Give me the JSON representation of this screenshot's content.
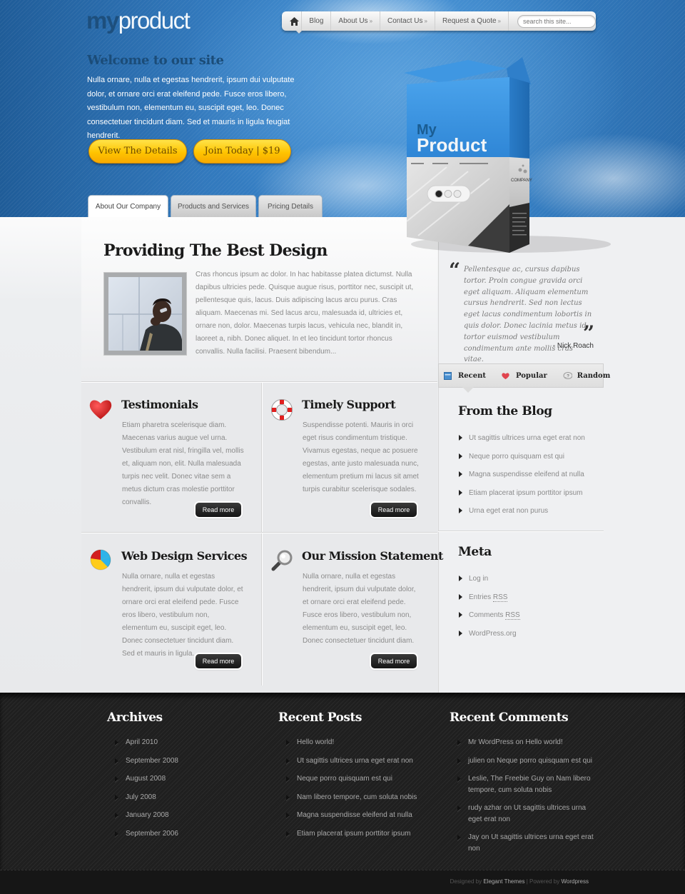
{
  "header": {
    "logo_my": "my",
    "logo_product": "product",
    "nav": {
      "home_icon": "home-icon",
      "items": [
        {
          "label": "Blog",
          "has_submenu": false
        },
        {
          "label": "About Us",
          "has_submenu": true
        },
        {
          "label": "Contact Us",
          "has_submenu": true
        },
        {
          "label": "Request a Quote",
          "has_submenu": true
        }
      ],
      "submenu_glyph": "»",
      "search_placeholder": "search this site..."
    },
    "welcome_title": "Welcome to our site",
    "intro_text": "Nulla ornare, nulla et egestas hendrerit, ipsum dui vulputate dolor, et ornare orci erat eleifend pede. Fusce eros libero, vestibulum non, elementum eu, suscipit eget, leo. Donec consectetuer tincidunt diam. Sed et mauris in ligula feugiat hendrerit.",
    "buttons": {
      "details": "View The Details",
      "join": "Join Today | $19"
    },
    "tabs": [
      {
        "label": "About Our Company",
        "active": true
      },
      {
        "label": "Products and Services",
        "active": false
      },
      {
        "label": "Pricing Details",
        "active": false
      }
    ],
    "product_box": {
      "line1": "My",
      "line2": "Product",
      "company": "COMPANY",
      "slider_active_index": 0,
      "slider_count": 3
    }
  },
  "feature": {
    "title": "Providing The Best Design",
    "text": "Cras rhoncus ipsum ac dolor. In hac habitasse platea dictumst. Nulla dapibus ultricies pede. Quisque augue risus, porttitor nec, suscipit ut, pellentesque quis, lacus. Duis adipiscing lacus arcu purus. Cras aliquam. Maecenas mi. Sed lacus arcu, malesuada id, ultricies et, ornare non, dolor. Maecenas turpis lacus, vehicula nec, blandit in, laoreet a, nibh. Donec aliquet. In et leo tincidunt tortor rhoncus convallis. Nulla facilisi. Praesent bibendum..."
  },
  "services": [
    {
      "icon": "heart-icon",
      "title": "Testimonials",
      "text": "Etiam pharetra scelerisque diam. Maecenas varius augue vel urna. Vestibulum erat nisl, fringilla vel, mollis et, aliquam non, elit. Nulla malesuada turpis nec velit. Donec vitae sem a metus dictum cras molestie porttitor convallis.",
      "button": "Read more"
    },
    {
      "icon": "lifebuoy-icon",
      "title": "Timely Support",
      "text": "Suspendisse potenti. Mauris in orci eget risus condimentum tristique. Vivamus egestas, neque ac posuere egestas, ante justo malesuada nunc, elementum pretium mi lacus sit amet turpis curabitur scelerisque sodales.",
      "button": "Read more"
    },
    {
      "icon": "pie-chart-icon",
      "title": "Web Design Services",
      "text": "Nulla ornare, nulla et egestas hendrerit, ipsum dui vulputate dolor, et ornare orci erat eleifend pede. Fusce eros libero, vestibulum non, elementum eu, suscipit eget, leo. Donec consectetuer tincidunt diam. Sed et mauris in ligula.",
      "button": "Read more"
    },
    {
      "icon": "magnifier-icon",
      "title": "Our Mission Statement",
      "text": "Nulla ornare, nulla et egestas hendrerit, ipsum dui vulputate dolor, et ornare orci erat eleifend pede. Fusce eros libero, vestibulum non, elementum eu, suscipit eget, leo. Donec consectetuer tincidunt diam.",
      "button": "Read more"
    }
  ],
  "sidebar": {
    "quote": {
      "text": "Pellentesque ac, cursus dapibus tortor. Proin congue gravida orci eget aliquam. Aliquam elementum cursus hendrerit. Sed non lectus eget lacus condimentum lobortis in quis dolor. Donec lacinia metus id tortor euismod vestibulum condimentum ante mollis cras vitae.",
      "author": "- Nick Roach",
      "open_mark": "“",
      "close_mark": "”"
    },
    "tabs": [
      {
        "label": "Recent",
        "icon": "calendar-icon"
      },
      {
        "label": "Popular",
        "icon": "heart-icon"
      },
      {
        "label": "Random",
        "icon": "question-bubble-icon"
      }
    ],
    "blog": {
      "title": "From the Blog",
      "items": [
        "Ut sagittis ultrices urna eget erat non",
        "Neque porro quisquam est qui",
        "Magna suspendisse eleifend at nulla",
        "Etiam placerat ipsum porttitor ipsum",
        "Urna eget erat non purus"
      ]
    },
    "meta": {
      "title": "Meta",
      "items": [
        {
          "text": "Log in",
          "abbr": ""
        },
        {
          "text": "Entries ",
          "abbr": "RSS"
        },
        {
          "text": "Comments ",
          "abbr": "RSS"
        },
        {
          "text": "WordPress.org",
          "abbr": ""
        }
      ]
    }
  },
  "footer": {
    "archives": {
      "title": "Archives",
      "items": [
        "April 2010",
        "September 2008",
        "August 2008",
        "July 2008",
        "January 2008",
        "September 2006"
      ]
    },
    "recent_posts": {
      "title": "Recent Posts",
      "items": [
        "Hello world!",
        "Ut sagittis ultrices urna eget erat non",
        "Neque porro quisquam est qui",
        "Nam libero tempore, cum soluta nobis",
        "Magna suspendisse eleifend at nulla",
        "Etiam placerat ipsum porttitor ipsum"
      ]
    },
    "recent_comments": {
      "title": "Recent Comments",
      "items": [
        "Mr WordPress on Hello world!",
        "julien on Neque porro quisquam est qui",
        "Leslie, The Freebie Guy on Nam libero tempore, cum soluta nobis",
        "rudy azhar on Ut sagittis ultrices urna eget erat non",
        "Jay on Ut sagittis ultrices urna eget erat non"
      ]
    },
    "credits": {
      "designed_by": "Designed by ",
      "designer": "Elegant Themes",
      "separator": " | Powered by ",
      "platform": "Wordpress"
    }
  },
  "colors": {
    "header_blue": "#3279bd",
    "button_yellow": "#ffc400",
    "footer_dark": "#1f1f1f",
    "text_gray": "#8b8b8b"
  }
}
